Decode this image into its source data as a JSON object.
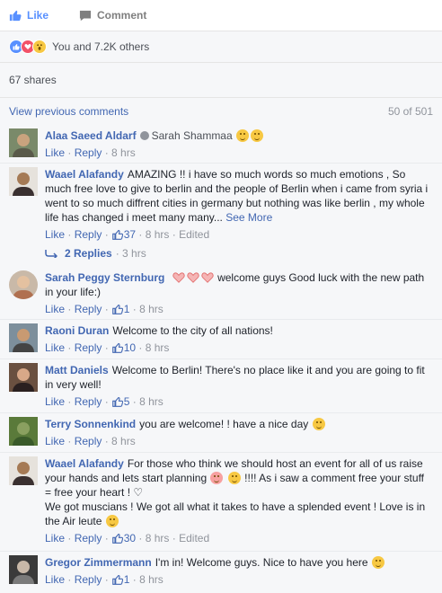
{
  "actions": {
    "like_label": "Like",
    "comment_label": "Comment"
  },
  "reactions": {
    "text": "You and 7.2K others",
    "icons": [
      "like-icon",
      "love-icon",
      "wow-icon"
    ]
  },
  "shares": {
    "text": "67 shares"
  },
  "comments_header": {
    "view_previous": "View previous comments",
    "count": "50 of 501"
  },
  "meta_labels": {
    "like": "Like",
    "reply": "Reply",
    "edited": "Edited"
  },
  "comments": [
    {
      "author": "Alaa Saeed Aldarf",
      "text": "Sarah Shammaa",
      "time": "8 hrs",
      "likes": "",
      "edited": false
    },
    {
      "author": "Waael Alafandy",
      "text": "AMAZING !! i have so much words so much emotions , So much free love to give to berlin and the people of Berlin when i came from syria i went to so much diffrent cities in germany but nothing was like berlin , my whole life has changed i meet many many...",
      "see_more": "See More",
      "time": "8 hrs",
      "likes": "37",
      "edited": true,
      "replies": {
        "label": "2 Replies",
        "time": "3 hrs"
      }
    },
    {
      "author": "Sarah Peggy Sternburg",
      "text": "welcome guys Good luck with the new path in your life:)",
      "time": "8 hrs",
      "likes": "1",
      "edited": false
    },
    {
      "author": "Raoni Duran",
      "text": "Welcome to the city of all nations!",
      "time": "8 hrs",
      "likes": "10",
      "edited": false
    },
    {
      "author": "Matt Daniels",
      "text": "Welcome to Berlin! There's no place like it and you are going to fit in very well!",
      "time": "8 hrs",
      "likes": "5",
      "edited": false
    },
    {
      "author": "Terry Sonnenkind",
      "text": "you are welcome! ! have a nice day",
      "time": "8 hrs",
      "likes": "",
      "edited": false
    },
    {
      "author": "Waael Alafandy",
      "text_1": "For those who think we should host an event for all of us raise your hands and lets start planning",
      "text_2": "!!!! As i saw a comment free your stuff = free your heart ! ♡",
      "text_3": "We got muscians ! We got all what it takes to have a splended event ! Love is in the Air leute",
      "time": "8 hrs",
      "likes": "30",
      "edited": true
    },
    {
      "author": "Gregor Zimmermann",
      "text": "I'm in! Welcome guys. Nice to have you here",
      "time": "8 hrs",
      "likes": "1",
      "edited": false
    }
  ]
}
